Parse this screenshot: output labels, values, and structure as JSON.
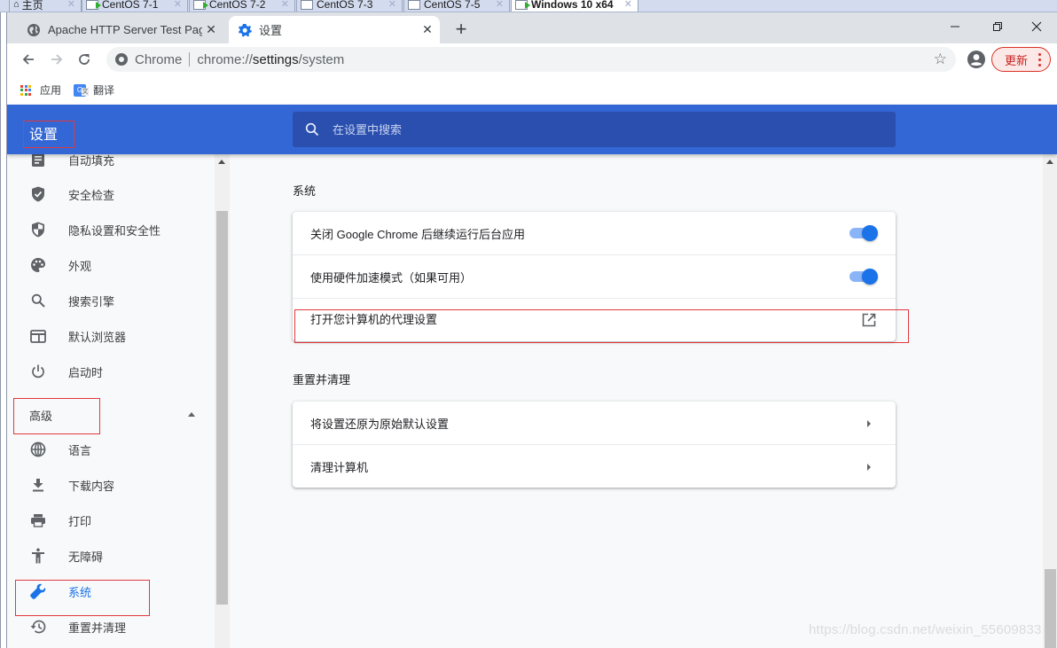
{
  "vm_tabs": [
    {
      "label": "主页",
      "icon": "home-icon",
      "active": false
    },
    {
      "label": "CentOS 7-1",
      "icon": "vm-running-icon",
      "active": false
    },
    {
      "label": "CentOS 7-2",
      "icon": "vm-running-icon",
      "active": false
    },
    {
      "label": "CentOS 7-3",
      "icon": "vm-icon",
      "active": false
    },
    {
      "label": "CentOS 7-5",
      "icon": "vm-icon",
      "active": false
    },
    {
      "label": "Windows 10 x64",
      "icon": "vm-running-icon",
      "active": true
    }
  ],
  "browser": {
    "tabs": [
      {
        "label": "Apache HTTP Server Test Page",
        "icon": "globe-icon",
        "active": false
      },
      {
        "label": "设置",
        "icon": "gear-icon",
        "active": true
      }
    ],
    "new_tab": "+",
    "omnibox": {
      "site_name": "Chrome",
      "url_prefix": "chrome://",
      "url_host": "settings",
      "url_path": "/system"
    },
    "update_button": "更新",
    "bookmarks": [
      {
        "label": "应用",
        "icon": "apps-grid-icon"
      },
      {
        "label": "翻译",
        "icon": "google-translate-icon"
      }
    ]
  },
  "settings": {
    "title": "设置",
    "search_placeholder": "在设置中搜索",
    "sidebar": {
      "items": [
        {
          "label": "自动填充",
          "icon": "autofill-icon"
        },
        {
          "label": "安全检查",
          "icon": "shield-check-icon"
        },
        {
          "label": "隐私设置和安全性",
          "icon": "privacy-shield-icon"
        },
        {
          "label": "外观",
          "icon": "palette-icon"
        },
        {
          "label": "搜索引擎",
          "icon": "search-icon"
        },
        {
          "label": "默认浏览器",
          "icon": "browser-window-icon"
        },
        {
          "label": "启动时",
          "icon": "power-icon"
        }
      ],
      "advanced_label": "高级",
      "advanced_items": [
        {
          "label": "语言",
          "icon": "globe-icon"
        },
        {
          "label": "下载内容",
          "icon": "download-icon"
        },
        {
          "label": "打印",
          "icon": "printer-icon"
        },
        {
          "label": "无障碍",
          "icon": "accessibility-icon"
        },
        {
          "label": "系统",
          "icon": "wrench-icon",
          "selected": true
        },
        {
          "label": "重置并清理",
          "icon": "restore-icon"
        }
      ]
    },
    "sections": {
      "system": {
        "title": "系统",
        "rows": [
          {
            "label": "关闭 Google Chrome 后继续运行后台应用",
            "control": "toggle",
            "checked": true
          },
          {
            "label": "使用硬件加速模式（如果可用）",
            "control": "toggle",
            "checked": true
          },
          {
            "label": "打开您计算机的代理设置",
            "control": "external-link"
          }
        ]
      },
      "reset": {
        "title": "重置并清理",
        "rows": [
          {
            "label": "将设置还原为原始默认设置",
            "control": "chevron"
          },
          {
            "label": "清理计算机",
            "control": "chevron"
          }
        ]
      }
    }
  },
  "colors": {
    "header_blue": "#3367d6",
    "accent_blue": "#1a73e8",
    "annotation_red": "#e0393e"
  },
  "watermark": "https://blog.csdn.net/weixin_55609833"
}
